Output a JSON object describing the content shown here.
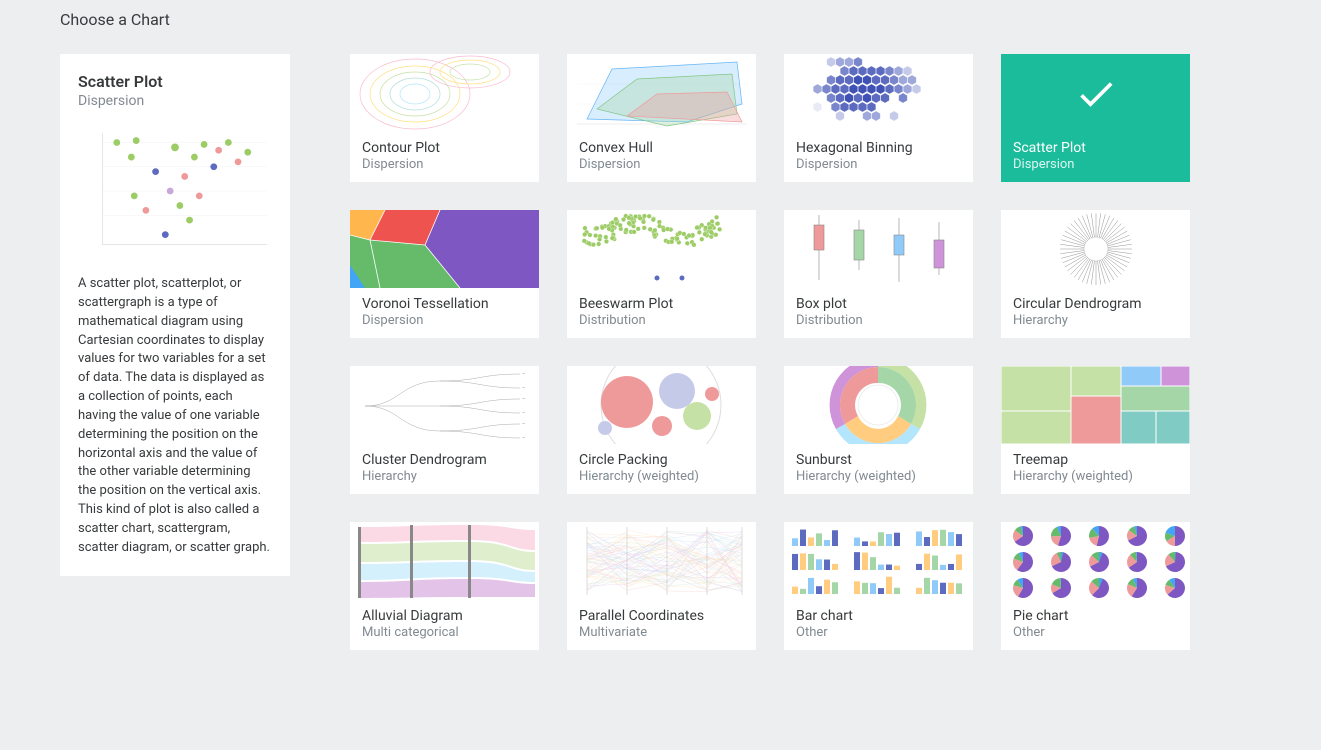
{
  "page": {
    "title": "Choose a Chart"
  },
  "detail": {
    "title": "Scatter Plot",
    "category": "Dispersion",
    "description": "A scatter plot, scatterplot, or scattergraph is a type of mathematical diagram using Cartesian coordinates to display values for two variables for a set of data. The data is displayed as a collection of points, each having the value of one variable determining the position on the horizontal axis and the value of the other variable determining the position on the vertical axis. This kind of plot is also called a scatter chart, scattergram, scatter diagram, or scatter graph."
  },
  "cards": [
    {
      "title": "Contour Plot",
      "category": "Dispersion",
      "selected": false
    },
    {
      "title": "Convex Hull",
      "category": "Dispersion",
      "selected": false
    },
    {
      "title": "Hexagonal Binning",
      "category": "Dispersion",
      "selected": false
    },
    {
      "title": "Scatter Plot",
      "category": "Dispersion",
      "selected": true
    },
    {
      "title": "Voronoi Tessellation",
      "category": "Dispersion",
      "selected": false
    },
    {
      "title": "Beeswarm Plot",
      "category": "Distribution",
      "selected": false
    },
    {
      "title": "Box plot",
      "category": "Distribution",
      "selected": false
    },
    {
      "title": "Circular Dendrogram",
      "category": "Hierarchy",
      "selected": false
    },
    {
      "title": "Cluster Dendrogram",
      "category": "Hierarchy",
      "selected": false
    },
    {
      "title": "Circle Packing",
      "category": "Hierarchy (weighted)",
      "selected": false
    },
    {
      "title": "Sunburst",
      "category": "Hierarchy (weighted)",
      "selected": false
    },
    {
      "title": "Treemap",
      "category": "Hierarchy (weighted)",
      "selected": false
    },
    {
      "title": "Alluvial Diagram",
      "category": "Multi categorical",
      "selected": false
    },
    {
      "title": "Parallel Coordinates",
      "category": "Multivariate",
      "selected": false
    },
    {
      "title": "Bar chart",
      "category": "Other",
      "selected": false
    },
    {
      "title": "Pie chart",
      "category": "Other",
      "selected": false
    }
  ],
  "colors": {
    "accent": "#1abc9c",
    "muted": "#818a91",
    "text": "#373a3c",
    "bg": "#eceeef"
  }
}
